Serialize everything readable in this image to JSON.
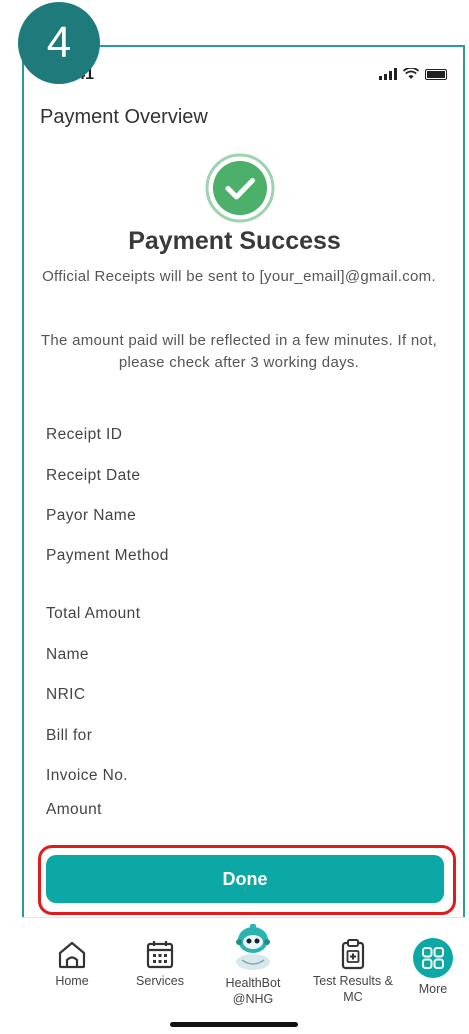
{
  "step_number": "4",
  "status_bar": {
    "time": "9:41"
  },
  "header": {
    "title": "Payment Overview"
  },
  "success": {
    "title": "Payment Success",
    "message_receipt": "Official Receipts will be sent to [your_email]@gmail.com.",
    "message_reflect": "The amount paid will be reflected in a few minutes. If not, please check after 3 working days."
  },
  "fields": [
    {
      "label": "Receipt ID"
    },
    {
      "label": "Receipt Date"
    },
    {
      "label": "Payor Name"
    },
    {
      "label": "Payment Method"
    },
    {
      "label": "Total Amount"
    },
    {
      "label": "Name"
    },
    {
      "label": "NRIC"
    },
    {
      "label": "Bill for"
    },
    {
      "label": "Invoice No."
    },
    {
      "label": "Amount"
    }
  ],
  "actions": {
    "done_label": "Done"
  },
  "nav": {
    "home": "Home",
    "services": "Services",
    "healthbot": "HealthBot @NHG",
    "test_results": "Test Results & MC",
    "more": "More"
  },
  "colors": {
    "accent": "#0ba8a6",
    "badge": "#1f7a7b",
    "success_green": "#4caf6a",
    "highlight_red": "#e01b1b"
  },
  "icons": {
    "success": "check-circle-icon",
    "home": "home-icon",
    "services": "calendar-icon",
    "healthbot": "robot-mascot-icon",
    "test_results": "clipboard-plus-icon",
    "more": "grid-icon"
  }
}
